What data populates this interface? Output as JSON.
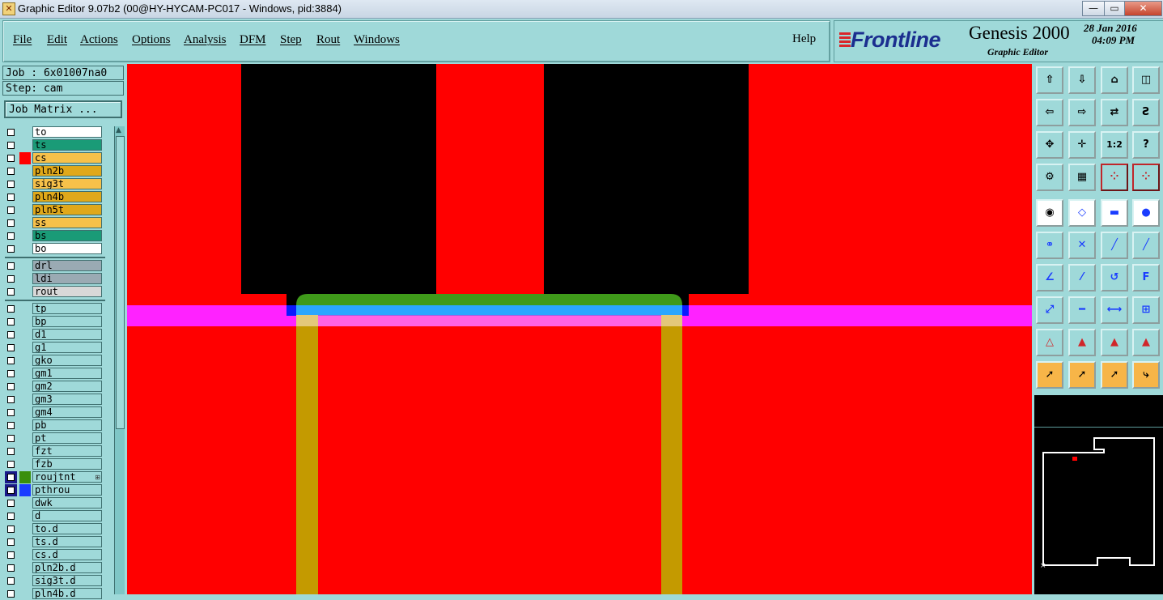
{
  "titlebar": {
    "app_icon_glyph": "✕",
    "title": "Graphic Editor 9.07b2 (00@HY-HYCAM-PC017 - Windows, pid:3884)",
    "minimize": "—",
    "maximize": "▭",
    "close": "✕"
  },
  "menu": {
    "items": [
      "File",
      "Edit",
      "Actions",
      "Options",
      "Analysis",
      "DFM",
      "Step",
      "Rout",
      "Windows"
    ],
    "help": "Help"
  },
  "brand": {
    "logo": "Frontline",
    "product": "Genesis 2000",
    "subtitle": "Graphic Editor",
    "date": "28 Jan 2016",
    "time": "04:09 PM"
  },
  "job": {
    "job_label": "Job : 6x01007na0",
    "step_label": "Step: cam",
    "matrix_button": "Job Matrix ..."
  },
  "layers": {
    "group1": [
      {
        "name": "to",
        "color": "#ffffff",
        "swatch": ""
      },
      {
        "name": "ts",
        "color": "#1a9b77",
        "swatch": ""
      },
      {
        "name": "cs",
        "color": "#f7c14a",
        "swatch": "#ff0000"
      },
      {
        "name": "pln2b",
        "color": "#e0a81a",
        "swatch": ""
      },
      {
        "name": "sig3t",
        "color": "#f7c14a",
        "swatch": ""
      },
      {
        "name": "pln4b",
        "color": "#e0a81a",
        "swatch": ""
      },
      {
        "name": "pln5t",
        "color": "#e0a81a",
        "swatch": ""
      },
      {
        "name": "ss",
        "color": "#f7c14a",
        "swatch": ""
      },
      {
        "name": "bs",
        "color": "#1a9b77",
        "swatch": ""
      },
      {
        "name": "bo",
        "color": "#ffffff",
        "swatch": ""
      }
    ],
    "group2": [
      {
        "name": "drl",
        "color": "#9aaab3",
        "swatch": ""
      },
      {
        "name": "ldi",
        "color": "#9aaab3",
        "swatch": ""
      },
      {
        "name": "rout",
        "color": "#d8d8d8",
        "swatch": ""
      }
    ],
    "group3": [
      {
        "name": "tp",
        "color": "#9fd9d9",
        "swatch": ""
      },
      {
        "name": "bp",
        "color": "#9fd9d9",
        "swatch": ""
      },
      {
        "name": "d1",
        "color": "#9fd9d9",
        "swatch": ""
      },
      {
        "name": "g1",
        "color": "#9fd9d9",
        "swatch": ""
      },
      {
        "name": "gko",
        "color": "#9fd9d9",
        "swatch": ""
      },
      {
        "name": "gm1",
        "color": "#9fd9d9",
        "swatch": ""
      },
      {
        "name": "gm2",
        "color": "#9fd9d9",
        "swatch": ""
      },
      {
        "name": "gm3",
        "color": "#9fd9d9",
        "swatch": ""
      },
      {
        "name": "gm4",
        "color": "#9fd9d9",
        "swatch": ""
      },
      {
        "name": "pb",
        "color": "#9fd9d9",
        "swatch": ""
      },
      {
        "name": "pt",
        "color": "#9fd9d9",
        "swatch": ""
      },
      {
        "name": "fzt",
        "color": "#9fd9d9",
        "swatch": ""
      },
      {
        "name": "fzb",
        "color": "#9fd9d9",
        "swatch": ""
      },
      {
        "name": "roujtnt",
        "color": "#9fd9d9",
        "swatch": "#3a8f0c",
        "selected": true,
        "marker": "⊞"
      },
      {
        "name": "pthrou",
        "color": "#9fd9d9",
        "swatch": "#1a3cff",
        "selected": true
      },
      {
        "name": "dwk",
        "color": "#9fd9d9",
        "swatch": ""
      },
      {
        "name": "d",
        "color": "#9fd9d9",
        "swatch": ""
      },
      {
        "name": "to.d",
        "color": "#9fd9d9",
        "swatch": ""
      },
      {
        "name": "ts.d",
        "color": "#9fd9d9",
        "swatch": ""
      },
      {
        "name": "cs.d",
        "color": "#9fd9d9",
        "swatch": ""
      },
      {
        "name": "pln2b.d",
        "color": "#9fd9d9",
        "swatch": ""
      },
      {
        "name": "sig3t.d",
        "color": "#9fd9d9",
        "swatch": ""
      },
      {
        "name": "pln4b.d",
        "color": "#9fd9d9",
        "swatch": ""
      }
    ]
  },
  "scrollbar": {
    "up_arrow": "▲"
  },
  "toolbox": {
    "rows": [
      [
        {
          "name": "view-up-icon",
          "glyph": "⇧",
          "style": "teal"
        },
        {
          "name": "view-down-icon",
          "glyph": "⇩",
          "style": "teal"
        },
        {
          "name": "home-icon",
          "glyph": "⌂",
          "style": "teal"
        },
        {
          "name": "window-split-icon",
          "glyph": "◫",
          "style": "teal"
        }
      ],
      [
        {
          "name": "view-left-icon",
          "glyph": "⇦",
          "style": "teal"
        },
        {
          "name": "view-right-icon",
          "glyph": "⇨",
          "style": "teal"
        },
        {
          "name": "mirror-icon",
          "glyph": "⇄",
          "style": "teal"
        },
        {
          "name": "s-shape-icon",
          "glyph": "Ƨ",
          "style": "teal"
        }
      ],
      [
        {
          "name": "zoom-fit-icon",
          "glyph": "✥",
          "style": "teal"
        },
        {
          "name": "pan-icon",
          "glyph": "✛",
          "style": "teal"
        },
        {
          "name": "scale-icon",
          "glyph": "1:2",
          "style": "teal"
        },
        {
          "name": "help-icon",
          "glyph": "?",
          "style": "teal"
        }
      ],
      [
        {
          "name": "settings-icon",
          "glyph": "⚙",
          "style": "teal"
        },
        {
          "name": "grid-icon",
          "glyph": "▦",
          "style": "teal"
        },
        {
          "name": "snap-icon-1",
          "glyph": "⁘",
          "style": "teal"
        },
        {
          "name": "snap-icon-2",
          "glyph": "⁘",
          "style": "teal"
        }
      ],
      [
        {
          "name": "record-icon",
          "glyph": "◉",
          "style": "white"
        },
        {
          "name": "shape-icon",
          "glyph": "◇",
          "style": "white"
        },
        {
          "name": "ruler-icon",
          "glyph": "▬",
          "style": "white"
        },
        {
          "name": "dot-icon",
          "glyph": "●",
          "style": "white"
        }
      ],
      [
        {
          "name": "connect-icon",
          "glyph": "⚭",
          "style": "teal"
        },
        {
          "name": "cross-icon",
          "glyph": "✕",
          "style": "teal"
        },
        {
          "name": "line-icon-1",
          "glyph": "╱",
          "style": "teal"
        },
        {
          "name": "line-icon-2",
          "glyph": "╱",
          "style": "teal"
        }
      ],
      [
        {
          "name": "angle-icon",
          "glyph": "∠",
          "style": "teal"
        },
        {
          "name": "slash-icon",
          "glyph": "⁄",
          "style": "teal"
        },
        {
          "name": "arc-icon",
          "glyph": "↺",
          "style": "teal"
        },
        {
          "name": "f-icon",
          "glyph": "F",
          "style": "teal"
        }
      ],
      [
        {
          "name": "move-icon",
          "glyph": "⤢",
          "style": "teal"
        },
        {
          "name": "minus-icon",
          "glyph": "━",
          "style": "teal"
        },
        {
          "name": "dim-icon",
          "glyph": "⟷",
          "style": "teal"
        },
        {
          "name": "group-icon",
          "glyph": "⊞",
          "style": "teal"
        }
      ],
      [
        {
          "name": "triangle-icon-1",
          "glyph": "△",
          "style": "teal"
        },
        {
          "name": "triangle-icon-2",
          "glyph": "▲",
          "style": "teal"
        },
        {
          "name": "triangle-icon-3",
          "glyph": "▲",
          "style": "teal"
        },
        {
          "name": "triangle-icon-4",
          "glyph": "▲",
          "style": "teal"
        }
      ],
      [
        {
          "name": "pointer-icon",
          "glyph": "➚",
          "style": "orange"
        },
        {
          "name": "select-box-icon",
          "glyph": "➚",
          "style": "orange"
        },
        {
          "name": "select-circle-icon",
          "glyph": "➚",
          "style": "orange"
        },
        {
          "name": "route-icon",
          "glyph": "⤷",
          "style": "orange"
        }
      ]
    ]
  },
  "colors": {
    "canvas_bg": "#ff0000",
    "copper_black": "#000000",
    "magenta_line": "#ff22ff",
    "green_feature": "#3f9a1a",
    "blue_feature": "#2aa6ff",
    "gold_outline": "#c49a00",
    "panel": "#9fd9d9"
  }
}
